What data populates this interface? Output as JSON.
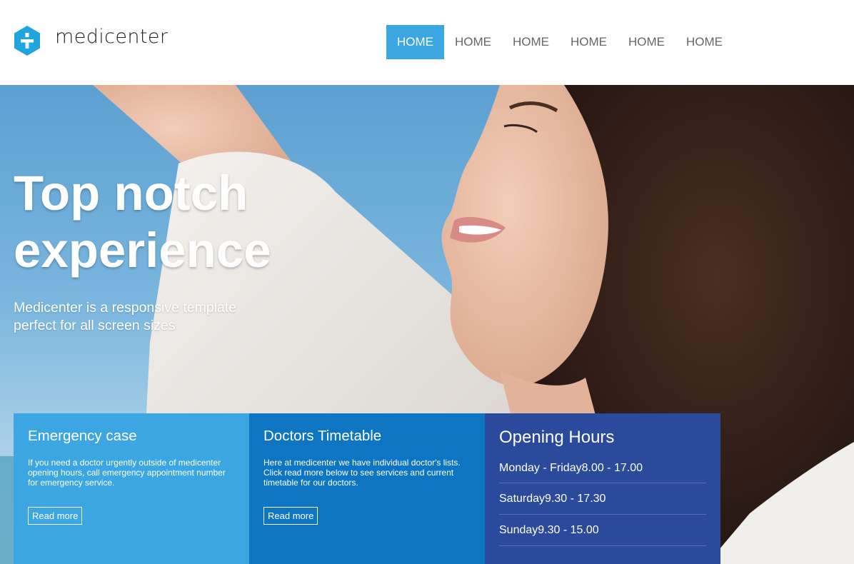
{
  "brand": {
    "name": "medicenter",
    "accent_color": "#3ba6e2",
    "logo_icon": "plus-hexagon-icon"
  },
  "nav": {
    "items": [
      {
        "label": "HOME",
        "active": true
      },
      {
        "label": "HOME",
        "active": false
      },
      {
        "label": "HOME",
        "active": false
      },
      {
        "label": "HOME",
        "active": false
      },
      {
        "label": "HOME",
        "active": false
      },
      {
        "label": "HOME",
        "active": false
      }
    ]
  },
  "hero": {
    "title_line1": "Top notch",
    "title_line2": "experience",
    "subtitle_line1": "Medicenter is a responsive template",
    "subtitle_line2": "perfect for all screen sizes"
  },
  "boxes": {
    "emergency": {
      "title": "Emergency case",
      "text": "If you need a doctor urgently outside of medicenter opening hours, call emergency appointment number for emergency service.",
      "button": "Read more",
      "color": "#3ba6e2"
    },
    "timetable": {
      "title": "Doctors Timetable",
      "text": "Here at medicenter we have individual doctor's lists. Click read more below to see services and current timetable for our doctors.",
      "button": "Read more",
      "color": "#0e75c2"
    },
    "hours": {
      "title": "Opening Hours",
      "color": "#2b4a9c",
      "rows": [
        {
          "day": "Monday - Friday",
          "time": "8.00 - 17.00"
        },
        {
          "day": "Saturday",
          "time": "9.30 - 17.30"
        },
        {
          "day": "Sunday",
          "time": "9.30 - 15.00"
        }
      ]
    }
  }
}
